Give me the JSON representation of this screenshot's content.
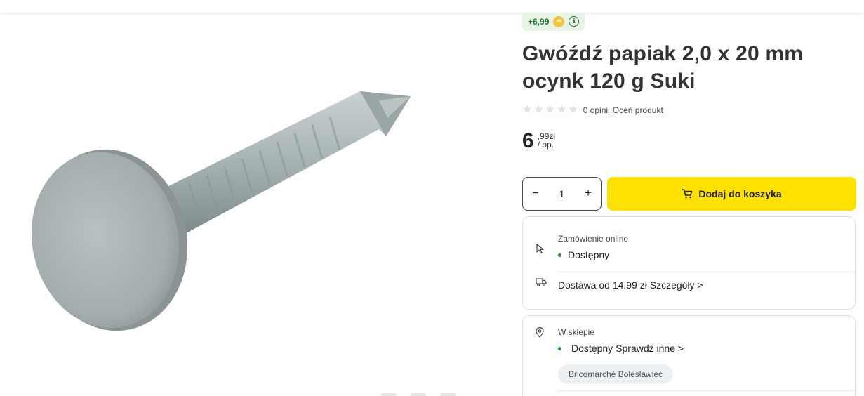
{
  "points": {
    "value": "+6,99",
    "coin_label": "zł",
    "info_symbol": "i"
  },
  "product": {
    "title_line1": "Gwóźdź papiak 2,0 x 20 mm",
    "title_line2": "ocynk 120 g Suki",
    "image_alt": "Gwóźdź papiak"
  },
  "rating": {
    "stars": 5,
    "filled": 0,
    "opinions": "0 opinii",
    "rate_link": "Oceń produkt"
  },
  "price": {
    "integer": "6",
    "decimal": ",99zł",
    "unit": "/ op."
  },
  "buy": {
    "minus": "−",
    "quantity": "1",
    "plus": "+",
    "cart_label": "Dodaj do koszyka"
  },
  "online": {
    "label": "Zamówienie online",
    "status": "Dostępny",
    "delivery": "Dostawa od 14,99 zł",
    "delivery_link": "Szczegóły >"
  },
  "store": {
    "label": "W sklepie",
    "status": "Dostępny",
    "check_link": "Sprawdź inne >",
    "store_name": "Bricomarché Bolesławiec"
  },
  "colors": {
    "accent_yellow": "#ffe100",
    "available_green": "#1f8a2e",
    "points_bg": "#e6f5e6"
  }
}
